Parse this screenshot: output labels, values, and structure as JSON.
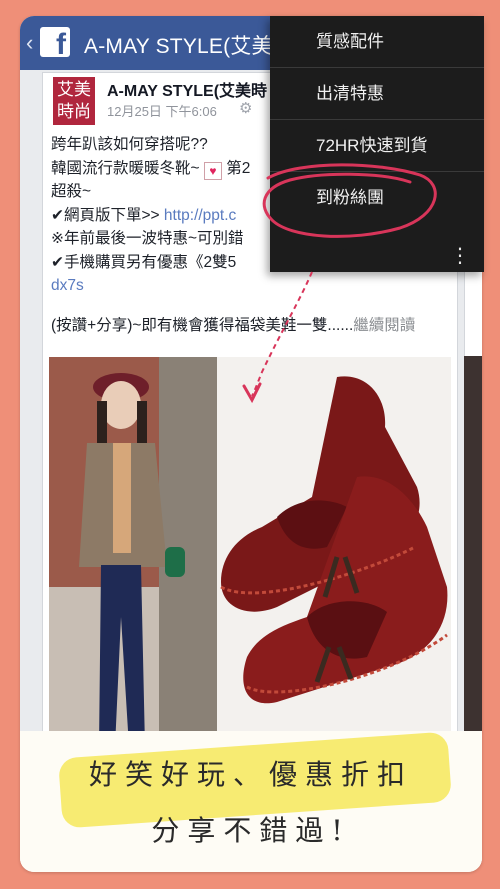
{
  "header": {
    "back_glyph": "‹",
    "logo": "f",
    "title": "A-MAY STYLE(艾美時尚)"
  },
  "post": {
    "avatar_text": "艾美\n時尚",
    "page_name": "A-MAY STYLE(艾美時",
    "time": "12月25日 下午6:06",
    "lines": {
      "l1": "跨年趴該如何穿搭呢??",
      "l2": "韓國流行款暖暖冬靴~",
      "l2b": "第2",
      "l3": "超殺~",
      "l4": "✔網頁版下單>>",
      "l4_link": "http://ppt.c",
      "l5": "※年前最後一波特惠~可別錯",
      "l6": "✔手機購買另有優惠《2雙5",
      "l7": "dx7s"
    },
    "share_text": "(按讚+分享)~即有機會獲得福袋美鞋一雙......",
    "read_more": "繼續閱讀"
  },
  "menu": {
    "items": [
      "質感配件",
      "出清特惠",
      "72HR快速到貨",
      "到粉絲團"
    ],
    "more_glyph": "⋮"
  },
  "banner": {
    "line1": "好笑好玩、優惠折扣",
    "line2": "分享不錯過!"
  },
  "colors": {
    "background": "#ef8f78",
    "facebook_blue": "#3b5998",
    "menu_bg": "#1c1c1c",
    "circle_annotation": "#d8355a",
    "highlight": "#f4e43b"
  }
}
